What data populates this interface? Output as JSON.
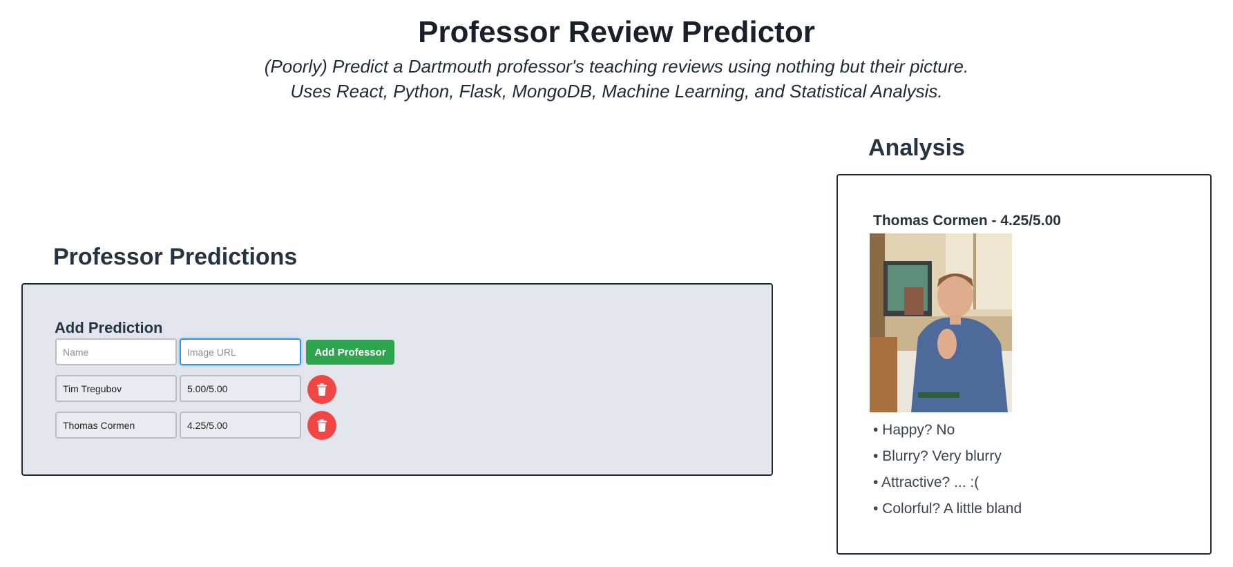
{
  "header": {
    "title": "Professor Review Predictor",
    "subtitle_line1": "(Poorly) Predict a Dartmouth professor's teaching reviews using nothing but their picture.",
    "subtitle_line2": "Uses React, Python, Flask, MongoDB, Machine Learning, and Statistical Analysis."
  },
  "predictions": {
    "heading": "Professor Predictions",
    "add_label": "Add Prediction",
    "name_placeholder": "Name",
    "url_placeholder": "Image URL",
    "add_button": "Add Professor",
    "rows": [
      {
        "name": "Tim Tregubov",
        "score": "5.00/5.00"
      },
      {
        "name": "Thomas Cormen",
        "score": "4.25/5.00"
      }
    ]
  },
  "analysis": {
    "heading": "Analysis",
    "name_score": "Thomas Cormen - 4.25/5.00",
    "bullets": [
      "• Happy? No",
      "• Blurry? Very blurry",
      "• Attractive? ... :(",
      "• Colorful? A little bland"
    ]
  },
  "icons": {
    "delete": "trash-icon"
  },
  "colors": {
    "add_button": "#2ea44f",
    "delete_button": "#f04646",
    "panel_bg": "#e2e6ec"
  }
}
